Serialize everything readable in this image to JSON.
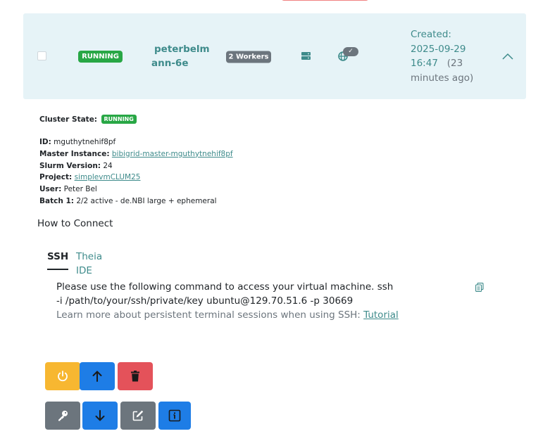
{
  "row": {
    "status": "RUNNING",
    "cluster_name": "peterbelmann-6e",
    "workers": "2 Workers",
    "check_mark": "✓",
    "created_label": "Created:",
    "created_date": "2025-09-29",
    "created_time": "16:47",
    "created_ago": "(23 minutes ago)"
  },
  "details": {
    "cluster_state_label": "Cluster State:",
    "cluster_state_value": "RUNNING",
    "id_label": "ID:",
    "id_value": "mguthytnehif8pf",
    "master_label": "Master Instance:",
    "master_value": "bibigrid-master-mguthytnehif8pf",
    "slurm_label": "Slurm Version:",
    "slurm_value": "24",
    "project_label": "Project:",
    "project_value": "simplevmCLUM25",
    "user_label": "User:",
    "user_value": "Peter Bel",
    "batch_label": "Batch 1:",
    "batch_value": "2/2 active - de.NBI large + ephemeral"
  },
  "connect": {
    "title": "How to Connect",
    "tabs": [
      "SSH",
      "Theia IDE"
    ],
    "command_text": "Please use the following command to access your virtual machine. ssh -i /path/to/your/ssh/private/key ubuntu@129.70.51.6 -p 30669",
    "learn_text": "Learn more about persistent terminal sessions when using SSH: ",
    "learn_link": "Tutorial"
  },
  "colors": {
    "row_bg": "#e6f3f7",
    "running_green": "#28a745",
    "link_teal": "#3e8b8b",
    "btn_yellow": "#f7b731",
    "btn_blue": "#1e7de6",
    "btn_red": "#e4525a",
    "btn_gray": "#6c757d"
  },
  "actions": {
    "row1": [
      "power-icon",
      "arrow-up-icon",
      "trash-icon"
    ],
    "row2": [
      "key-icon",
      "arrow-down-icon",
      "edit-icon",
      "info-icon"
    ]
  }
}
